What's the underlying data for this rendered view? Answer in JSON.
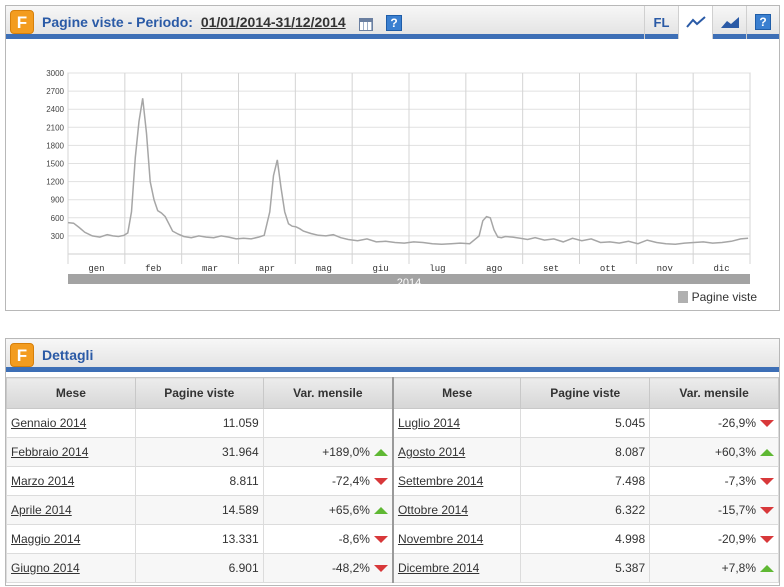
{
  "top_panel": {
    "logo_letter": "F",
    "title": "Pagine viste - Periodo:",
    "period": "01/01/2014-31/12/2014",
    "help": "?",
    "toolbar": {
      "fl_label": "FL"
    }
  },
  "chart_data": {
    "type": "line",
    "title": "",
    "ylim": [
      0,
      3000
    ],
    "yticks": [
      300,
      600,
      900,
      1200,
      1500,
      1800,
      2100,
      2400,
      2700,
      3000
    ],
    "xticks": [
      "gen",
      "feb",
      "mar",
      "apr",
      "mag",
      "giu",
      "lug",
      "ago",
      "set",
      "ott",
      "nov",
      "dic"
    ],
    "band_label": "2014",
    "grid": true,
    "legend_position": "bottom-right",
    "series": [
      {
        "name": "Pagine viste",
        "color": "#a6a6a6",
        "x_days": [
          0,
          3,
          6,
          9,
          13,
          17,
          21,
          24,
          27,
          30,
          32,
          34,
          36,
          38,
          40,
          42,
          44,
          46,
          48,
          50,
          52,
          54,
          56,
          59,
          62,
          66,
          70,
          74,
          78,
          82,
          86,
          90,
          94,
          98,
          102,
          105,
          108,
          110,
          112,
          114,
          116,
          118,
          120,
          122,
          124,
          126,
          130,
          134,
          138,
          142,
          146,
          150,
          155,
          160,
          165,
          170,
          175,
          180,
          185,
          190,
          195,
          200,
          205,
          210,
          215,
          220,
          222,
          224,
          226,
          228,
          230,
          232,
          234,
          238,
          242,
          246,
          250,
          255,
          260,
          265,
          270,
          275,
          280,
          285,
          290,
          295,
          300,
          305,
          310,
          315,
          320,
          325,
          330,
          335,
          340,
          345,
          350,
          355,
          360,
          364
        ],
        "values": [
          520,
          510,
          440,
          360,
          300,
          280,
          320,
          300,
          290,
          310,
          350,
          700,
          1600,
          2200,
          2580,
          2000,
          1200,
          900,
          720,
          680,
          620,
          500,
          380,
          330,
          290,
          270,
          300,
          280,
          270,
          300,
          280,
          250,
          260,
          250,
          280,
          310,
          700,
          1300,
          1560,
          1100,
          700,
          500,
          460,
          450,
          420,
          380,
          340,
          310,
          300,
          320,
          270,
          240,
          220,
          250,
          200,
          210,
          190,
          180,
          200,
          190,
          170,
          160,
          170,
          180,
          170,
          300,
          550,
          620,
          600,
          400,
          280,
          270,
          290,
          280,
          260,
          240,
          270,
          230,
          250,
          200,
          260,
          220,
          250,
          190,
          200,
          180,
          210,
          170,
          230,
          190,
          170,
          160,
          180,
          190,
          200,
          180,
          190,
          210,
          250,
          260
        ]
      }
    ]
  },
  "bottom_panel": {
    "logo_letter": "F",
    "title": "Dettagli",
    "headers": [
      "Mese",
      "Pagine viste",
      "Var. mensile",
      "Mese",
      "Pagine viste",
      "Var. mensile"
    ],
    "rows": [
      {
        "m1": "Gennaio 2014",
        "v1": "11.059",
        "p1": "",
        "a1": "",
        "m2": "Luglio 2014",
        "v2": "5.045",
        "p2": "-26,9%",
        "a2": "down"
      },
      {
        "m1": "Febbraio 2014",
        "v1": "31.964",
        "p1": "+189,0%",
        "a1": "up",
        "m2": "Agosto 2014",
        "v2": "8.087",
        "p2": "+60,3%",
        "a2": "up"
      },
      {
        "m1": "Marzo 2014",
        "v1": "8.811",
        "p1": "-72,4%",
        "a1": "down",
        "m2": "Settembre 2014",
        "v2": "7.498",
        "p2": "-7,3%",
        "a2": "down"
      },
      {
        "m1": "Aprile 2014",
        "v1": "14.589",
        "p1": "+65,6%",
        "a1": "up",
        "m2": "Ottobre 2014",
        "v2": "6.322",
        "p2": "-15,7%",
        "a2": "down"
      },
      {
        "m1": "Maggio 2014",
        "v1": "13.331",
        "p1": "-8,6%",
        "a1": "down",
        "m2": "Novembre 2014",
        "v2": "4.998",
        "p2": "-20,9%",
        "a2": "down"
      },
      {
        "m1": "Giugno 2014",
        "v1": "6.901",
        "p1": "-48,2%",
        "a1": "down",
        "m2": "Dicembre 2014",
        "v2": "5.387",
        "p2": "+7,8%",
        "a2": "up"
      }
    ]
  }
}
